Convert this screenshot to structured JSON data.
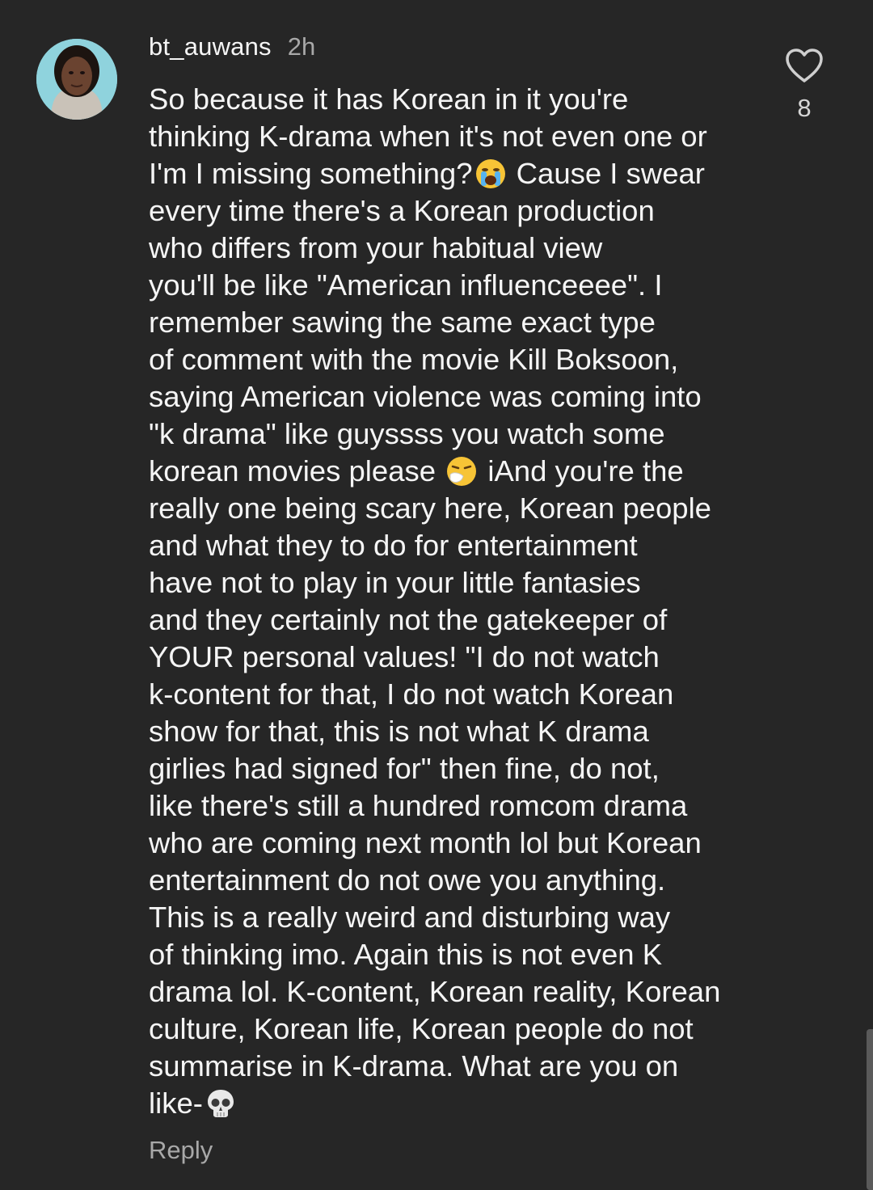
{
  "comment": {
    "username": "bt_auwans",
    "timestamp": "2h",
    "text_segments": [
      "So because it has Korean in it you're\nthinking K-drama when it's not even one or\nI'm I missing something?",
      " Cause I swear\nevery time there's a Korean production\nwho differs from your habitual view\nyou'll be like \"American influenceeee\". I\nremember sawing the same exact type\nof comment with the movie Kill Boksoon,\nsaying American violence was coming into\n\"k drama\" like guyssss you watch some\nkorean movies please ",
      " iAnd you're the\nreally one being scary here, Korean people\nand what they to do for entertainment\nhave not to play in your little fantasies\nand they certainly not the gatekeeper of\nYOUR  personal values! \"I do not watch\nk-content for that, I do not watch Korean\nshow for that, this is not what K drama\ngirlies had signed for\" then fine, do not,\nlike there's still a hundred romcom drama\nwho are coming next month lol but Korean\nentertainment do not owe you anything.\nThis is a really weird and disturbing way\nof thinking imo. Again this is not even K\ndrama lol. K-content, Korean reality, Korean\nculture, Korean life, Korean people do not\nsummarise in K-drama. What are you on\nlike-"
    ],
    "emojis": [
      "crying-face-icon",
      "sneezing-face-icon",
      "skull-icon"
    ],
    "reply_label": "Reply",
    "like_count": "8",
    "like_icon": "heart-outline-icon"
  },
  "colors": {
    "background": "#262626",
    "primary_text": "#f5f5f5",
    "secondary_text": "#a8a8a8",
    "avatar_bg": "#8fd3dd"
  }
}
